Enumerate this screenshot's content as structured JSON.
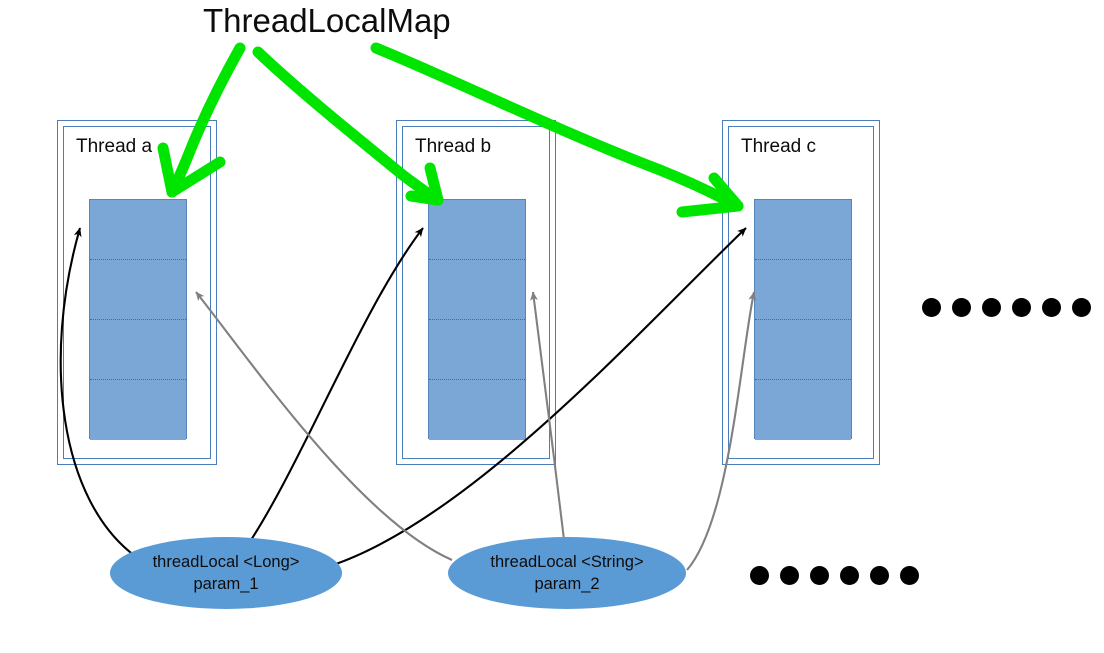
{
  "title": "ThreadLocalMap",
  "threads": [
    {
      "label": "Thread a",
      "cells": 4
    },
    {
      "label": "Thread b",
      "cells": 4
    },
    {
      "label": "Thread c",
      "cells": 4
    }
  ],
  "threadlocals": [
    {
      "type_line": "threadLocal <Long>",
      "param_line": "param_1"
    },
    {
      "type_line": "threadLocal <String>",
      "param_line": "param_2"
    }
  ],
  "ellipsis": {
    "top_right_dots": 6,
    "bottom_right_dots": 6
  },
  "colors": {
    "annotation_green": "#00e500",
    "cell_fill": "#7ba7d7",
    "ellipse_fill": "#5b9bd5",
    "frame_border": "#4a7ebb",
    "black_arrow": "#000000",
    "gray_arrow": "#808080",
    "dot": "#000000"
  },
  "annotations": {
    "green_arrow_count": 3,
    "green_arrow_target": "map-table-top-cell"
  }
}
